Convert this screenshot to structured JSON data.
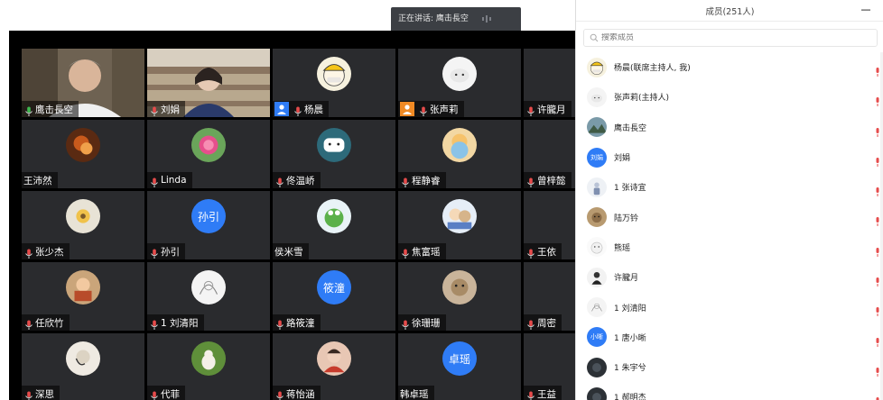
{
  "speaking_banner": {
    "label": "正在讲话: 鹰击長空"
  },
  "tiles": [
    {
      "name": "鹰击長空",
      "type": "video",
      "mic": true,
      "mic_color": "#3fb950",
      "active": true
    },
    {
      "name": "刘娟",
      "type": "video",
      "mic": true
    },
    {
      "name": "杨晨",
      "type": "avatar",
      "mic": true,
      "badge": "host-blue",
      "avatar_icon": "yellow-hat-cartoon"
    },
    {
      "name": "张声莉",
      "type": "avatar",
      "mic": true,
      "badge": "host-orange",
      "avatar_icon": "white-cat-photo"
    },
    {
      "name": "许朧月",
      "type": "avatar",
      "mic": true
    },
    {
      "name": "王沛然",
      "type": "avatar",
      "mic": false,
      "avatar_icon": "dark-warm-photo"
    },
    {
      "name": "Linda",
      "type": "avatar",
      "mic": true,
      "avatar_icon": "pink-rose-photo"
    },
    {
      "name": "佟温峤",
      "type": "avatar",
      "mic": true,
      "avatar_icon": "polar-bear-cartoon"
    },
    {
      "name": "程静睿",
      "type": "avatar",
      "mic": true,
      "avatar_icon": "anime-girl-photo"
    },
    {
      "name": "曾梓懿",
      "type": "avatar",
      "mic": true
    },
    {
      "name": "张少杰",
      "type": "avatar",
      "mic": true,
      "avatar_icon": "flower-field-photo"
    },
    {
      "name": "孙引",
      "type": "text-avatar",
      "avatar_text": "孙引",
      "mic": true
    },
    {
      "name": "侯米雪",
      "type": "avatar",
      "mic": false,
      "avatar_icon": "frog-cartoon"
    },
    {
      "name": "焦富瑶",
      "type": "avatar",
      "mic": true,
      "avatar_icon": "anime-couple-photo"
    },
    {
      "name": "王依",
      "type": "avatar",
      "mic": true
    },
    {
      "name": "任欣竹",
      "type": "avatar",
      "mic": true,
      "avatar_icon": "orange-girl-photo"
    },
    {
      "name": "1 刘清阳",
      "type": "avatar",
      "mic": true,
      "avatar_icon": "sketch-photo"
    },
    {
      "name": "路筱潼",
      "type": "text-avatar",
      "avatar_text": "筱潼",
      "mic": true
    },
    {
      "name": "徐珊珊",
      "type": "avatar",
      "mic": true,
      "avatar_icon": "bear-plush-photo"
    },
    {
      "name": "周密",
      "type": "avatar",
      "mic": true
    },
    {
      "name": "深思",
      "type": "avatar",
      "mic": true,
      "avatar_icon": "portrait-sketch-photo"
    },
    {
      "name": "代菲",
      "type": "avatar",
      "mic": true,
      "avatar_icon": "dog-grass-photo"
    },
    {
      "name": "蒋怡涵",
      "type": "avatar",
      "mic": true,
      "avatar_icon": "red-girl-photo"
    },
    {
      "name": "韩卓瑶",
      "type": "text-avatar",
      "avatar_text": "卓瑶",
      "mic": false
    },
    {
      "name": "王益",
      "type": "avatar",
      "mic": true
    }
  ],
  "panel": {
    "title": "成员(251人)",
    "search_placeholder": "搜索成员",
    "members": [
      {
        "name": "杨晨(联席主持人, 我)",
        "avatar_icon": "yellow-hat-cartoon"
      },
      {
        "name": "张声莉(主持人)",
        "avatar_icon": "white-cat-photo"
      },
      {
        "name": "鹰击長空",
        "avatar_icon": "mountain-photo"
      },
      {
        "name": "刘娟",
        "avatar_text": "刘娟"
      },
      {
        "name": "1 张诗宜",
        "avatar_icon": "figure-photo"
      },
      {
        "name": "陆万钤",
        "avatar_icon": "brown-plush-photo"
      },
      {
        "name": "熊瑶",
        "avatar_icon": "white-bear-cartoon"
      },
      {
        "name": "许朧月",
        "avatar_icon": "dark-figure-photo"
      },
      {
        "name": "1 刘清阳",
        "avatar_icon": "sketch-photo"
      },
      {
        "name": "1 唐小晰",
        "avatar_text": "小晰"
      },
      {
        "name": "1 朱宇兮",
        "avatar_icon": "dark-circle-photo"
      },
      {
        "name": "1 郝明杰",
        "avatar_icon": "dark-circle-photo"
      }
    ]
  },
  "colors": {
    "accent_blue": "#2f7cf6",
    "active_green": "#34b24a",
    "mic_red": "#e64b4b",
    "tile_bg": "#2a2b2e"
  }
}
